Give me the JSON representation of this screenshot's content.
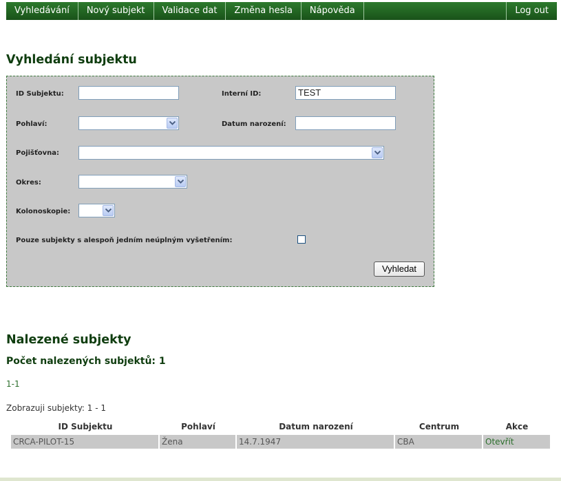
{
  "nav": {
    "items": [
      "Vyhledávání",
      "Nový subjekt",
      "Validace dat",
      "Změna hesla",
      "Nápověda"
    ],
    "logout": "Log out"
  },
  "search": {
    "heading": "Vyhledání subjektu",
    "id_label": "ID Subjektu:",
    "id_value": "",
    "internal_label": "Interní ID:",
    "internal_value": "TEST",
    "gender_label": "Pohlaví:",
    "gender_value": "",
    "dob_label": "Datum narození:",
    "dob_value": "",
    "insurance_label": "Pojišťovna:",
    "insurance_value": "",
    "district_label": "Okres:",
    "district_value": "",
    "colonoscopy_label": "Kolonoskopie:",
    "colonoscopy_value": "",
    "incomplete_label": "Pouze subjekty s alespoň jedním neúplným vyšetřením:",
    "incomplete_checked": false,
    "submit": "Vyhledat"
  },
  "results": {
    "heading": "Nalezené subjekty",
    "count_text": "Počet nalezených subjektů: 1",
    "pager": "1-1",
    "showing": "Zobrazuji subjekty: 1 - 1",
    "columns": [
      "ID Subjektu",
      "Pohlaví",
      "Datum narození",
      "Centrum",
      "Akce"
    ],
    "rows": [
      [
        "CRCA-PILOT-15",
        "Žena",
        "14.7.1947",
        "CBA",
        "Otevřít"
      ]
    ]
  }
}
